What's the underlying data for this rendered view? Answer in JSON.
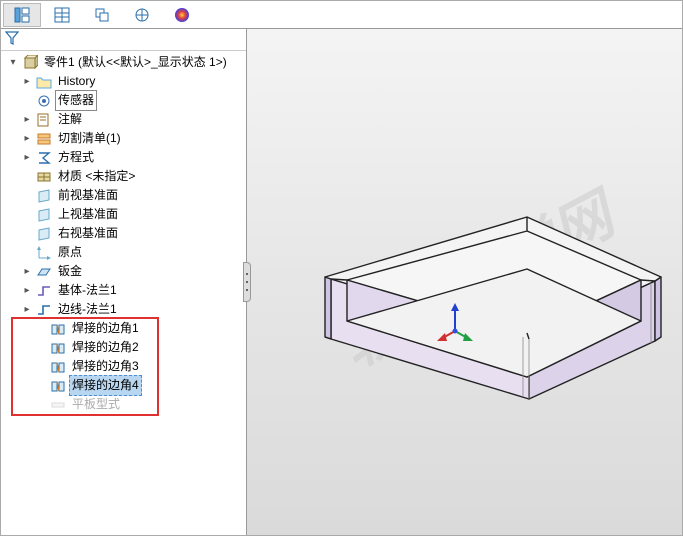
{
  "toolbar": {
    "buttons": [
      "feature-manager-icon",
      "property-manager-icon",
      "config-manager-icon",
      "dimxpert-icon",
      "appearance-icon"
    ]
  },
  "filter": {
    "tooltip": "filter"
  },
  "part": {
    "label": "零件1  (默认<<默认>_显示状态 1>)"
  },
  "tree": [
    {
      "id": "history",
      "label": "History",
      "indent": 1,
      "chevron": "right",
      "icon": "folder",
      "color": "#58a7e8"
    },
    {
      "id": "sensors",
      "label": "传感器",
      "indent": 1,
      "chevron": "none",
      "icon": "sensor",
      "color": "#3a6fb0",
      "boxed": true
    },
    {
      "id": "annotations",
      "label": "注解",
      "indent": 1,
      "chevron": "right",
      "icon": "note",
      "color": "#9a6f2a"
    },
    {
      "id": "cutlist",
      "label": "切割清单(1)",
      "indent": 1,
      "chevron": "right",
      "icon": "cutlist",
      "color": "#c77a2b"
    },
    {
      "id": "equations",
      "label": "方程式",
      "indent": 1,
      "chevron": "right",
      "icon": "sigma",
      "color": "#2a6fab"
    },
    {
      "id": "material",
      "label": "材质 <未指定>",
      "indent": 1,
      "chevron": "none",
      "icon": "material",
      "color": "#8a742c"
    },
    {
      "id": "front-plane",
      "label": "前视基准面",
      "indent": 1,
      "chevron": "none",
      "icon": "plane",
      "color": "#6aa7c9"
    },
    {
      "id": "top-plane",
      "label": "上视基准面",
      "indent": 1,
      "chevron": "none",
      "icon": "plane",
      "color": "#6aa7c9"
    },
    {
      "id": "right-plane",
      "label": "右视基准面",
      "indent": 1,
      "chevron": "none",
      "icon": "plane",
      "color": "#6aa7c9"
    },
    {
      "id": "origin",
      "label": "原点",
      "indent": 1,
      "chevron": "none",
      "icon": "origin",
      "color": "#6aa7c9"
    },
    {
      "id": "sheetmetal",
      "label": "钣金",
      "indent": 1,
      "chevron": "right",
      "icon": "sheetmetal",
      "color": "#2a6fab"
    },
    {
      "id": "base-flange",
      "label": "基体-法兰1",
      "indent": 1,
      "chevron": "right",
      "icon": "flange",
      "color": "#6a5bb7"
    },
    {
      "id": "edge-flange",
      "label": "边线-法兰1",
      "indent": 1,
      "chevron": "right",
      "icon": "flange",
      "color": "#2a6fab"
    },
    {
      "id": "weld-corner-1",
      "label": "焊接的边角1",
      "indent": 2,
      "chevron": "none",
      "icon": "weld",
      "color": "#2a6fab"
    },
    {
      "id": "weld-corner-2",
      "label": "焊接的边角2",
      "indent": 2,
      "chevron": "none",
      "icon": "weld",
      "color": "#2a6fab"
    },
    {
      "id": "weld-corner-3",
      "label": "焊接的边角3",
      "indent": 2,
      "chevron": "none",
      "icon": "weld",
      "color": "#2a6fab"
    },
    {
      "id": "weld-corner-4",
      "label": "焊接的边角4",
      "indent": 2,
      "chevron": "none",
      "icon": "weld",
      "color": "#2a6fab",
      "selected": true
    },
    {
      "id": "flat-pattern",
      "label": "平板型式",
      "indent": 2,
      "chevron": "none",
      "icon": "flat",
      "color": "#bbb",
      "muted": true
    }
  ],
  "viewport": {
    "watermark": "软件自学网"
  },
  "model": {
    "face_color": "#e8dff0",
    "top_color": "#f5f5f5",
    "edge_color": "#222"
  },
  "highlight": {
    "top_index": 13,
    "count": 5
  }
}
